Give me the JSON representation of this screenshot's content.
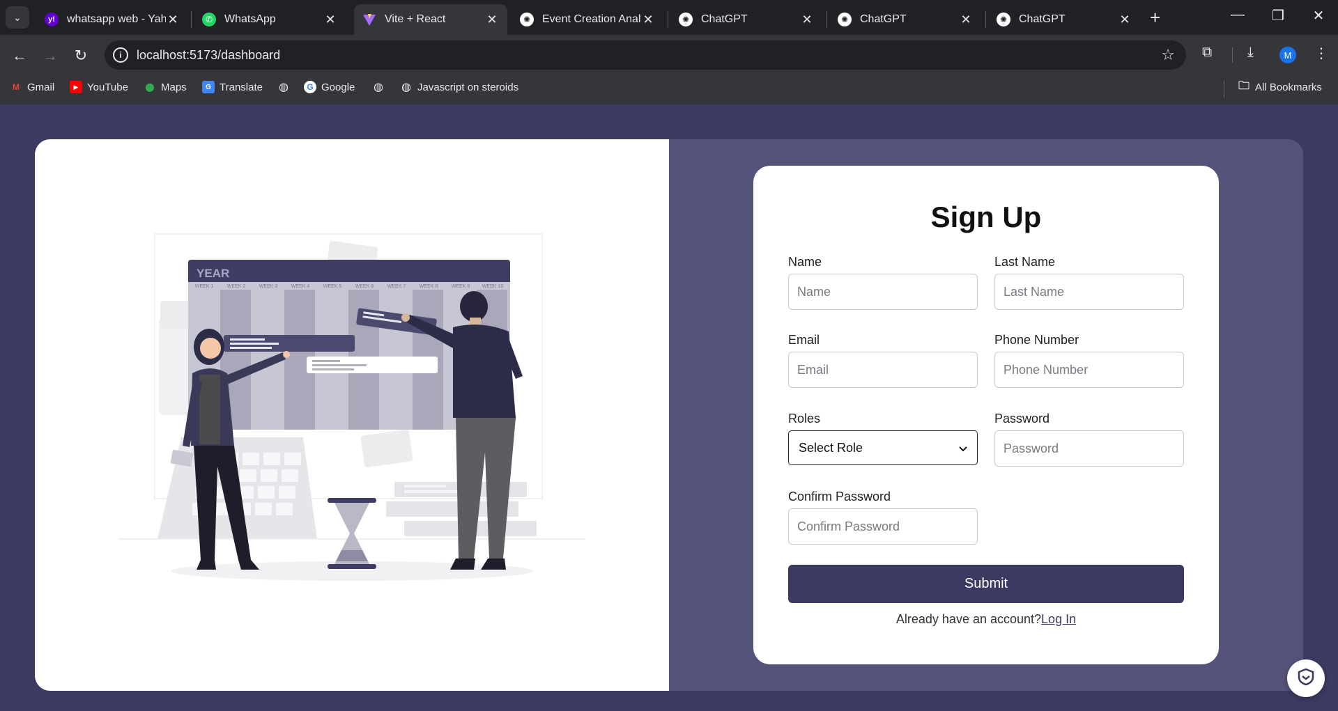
{
  "browser": {
    "tabs": [
      {
        "title": "whatsapp web - Yaho",
        "icon": "yahoo-icon",
        "color": "#5f01d1",
        "glyph": "y!",
        "active": false
      },
      {
        "title": "WhatsApp",
        "icon": "whatsapp-icon",
        "color": "#25d366",
        "glyph": "✆",
        "active": false
      },
      {
        "title": "Vite + React",
        "icon": "vite-icon",
        "color": "#a76cff",
        "glyph": "▼",
        "active": true
      },
      {
        "title": "Event Creation Analy",
        "icon": "chatgpt-icon",
        "color": "#ffffff",
        "glyph": "✺",
        "active": false
      },
      {
        "title": "ChatGPT",
        "icon": "chatgpt-icon",
        "color": "#ffffff",
        "glyph": "✺",
        "active": false
      },
      {
        "title": "ChatGPT",
        "icon": "chatgpt-icon",
        "color": "#ffffff",
        "glyph": "✺",
        "active": false
      },
      {
        "title": "ChatGPT",
        "icon": "chatgpt-icon",
        "color": "#ffffff",
        "glyph": "✺",
        "active": false
      }
    ],
    "url": "localhost:5173/dashboard",
    "bookmarks": [
      {
        "label": "Gmail",
        "icon": "gmail-icon"
      },
      {
        "label": "YouTube",
        "icon": "youtube-icon"
      },
      {
        "label": "Maps",
        "icon": "maps-icon"
      },
      {
        "label": "Translate",
        "icon": "translate-icon"
      },
      {
        "label": "",
        "icon": "globe-icon"
      },
      {
        "label": "Google",
        "icon": "google-icon"
      },
      {
        "label": "",
        "icon": "globe-icon"
      },
      {
        "label": "Javascript on steroids",
        "icon": "globe-icon"
      }
    ],
    "all_bookmarks": "All Bookmarks",
    "profile_initial": "M"
  },
  "illustration": {
    "board_title": "YEAR",
    "weeks": [
      "WEEK 1",
      "WEEK 2",
      "WEEK 3",
      "WEEK 4",
      "WEEK 5",
      "WEEK 6",
      "WEEK 7",
      "WEEK 8",
      "WEEK 9",
      "WEEK 10"
    ]
  },
  "form": {
    "title": "Sign Up",
    "name": {
      "label": "Name",
      "placeholder": "Name"
    },
    "last_name": {
      "label": "Last Name",
      "placeholder": "Last Name"
    },
    "email": {
      "label": "Email",
      "placeholder": "Email"
    },
    "phone": {
      "label": "Phone Number",
      "placeholder": "Phone Number"
    },
    "roles": {
      "label": "Roles",
      "selected": "Select Role"
    },
    "password": {
      "label": "Password",
      "placeholder": "Password"
    },
    "confirm": {
      "label": "Confirm Password",
      "placeholder": "Confirm Password"
    },
    "submit": "Submit",
    "have_account": "Already have an account?",
    "login": "Log In"
  },
  "colors": {
    "primary": "#3b3a62",
    "panel": "#545379"
  }
}
